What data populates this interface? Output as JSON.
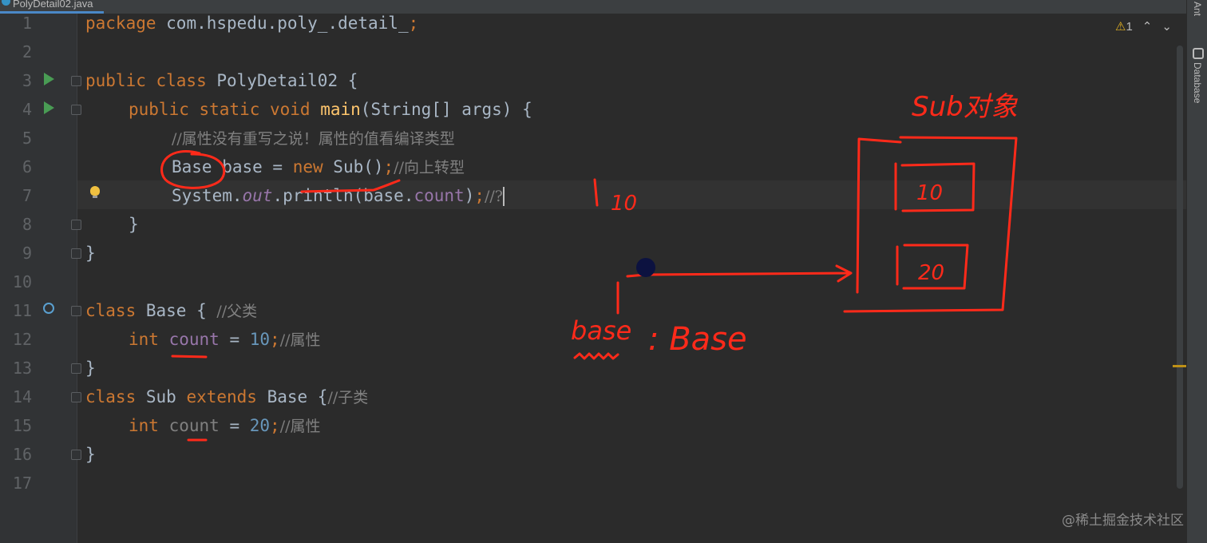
{
  "tab": {
    "filename": "PolyDetail02.java"
  },
  "editor": {
    "line_numbers": [
      "1",
      "2",
      "3",
      "4",
      "5",
      "6",
      "7",
      "8",
      "9",
      "10",
      "11",
      "12",
      "13",
      "14",
      "15",
      "16",
      "17"
    ],
    "code": {
      "l1_kw": "package ",
      "l1_rest": "com.hspedu.poly_.detail_",
      "l1_semi": ";",
      "l3_kw": "public class ",
      "l3_name": "PolyDetail02 {",
      "l4_kw": "public static void ",
      "l4_fn": "main",
      "l4_rest": "(String[] args) {",
      "l5_comment": "//属性没有重写之说！属性的值看编译类型",
      "l6_a": "Base base = ",
      "l6_kw": "new ",
      "l6_b": "Sub()",
      "l6_semi": ";",
      "l6_comment": "//向上转型",
      "l7_a": "System.",
      "l7_out": "out",
      "l7_b": ".println(base.",
      "l7_count": "count",
      "l7_c": ")",
      "l7_semi": ";",
      "l7_comment": "//?",
      "l8": "}",
      "l9": "}",
      "l11_kw": "class ",
      "l11_name": "Base { ",
      "l11_comment": "//父类",
      "l12_kw": "int ",
      "l12_field": "count",
      "l12_eq": " = ",
      "l12_num": "10",
      "l12_semi": ";",
      "l12_comment": "//属性",
      "l13": "}",
      "l14_kw": "class ",
      "l14_name": "Sub ",
      "l14_kw2": "extends ",
      "l14_base": "Base {",
      "l14_comment": "//子类",
      "l15_kw": "int ",
      "l15_field": "count",
      "l15_eq": " = ",
      "l15_num": "20",
      "l15_semi": ";",
      "l15_comment": "//属性",
      "l16": "}"
    }
  },
  "inspection": {
    "warning_count": "1",
    "up_arrow": "⌃",
    "down_arrow": "⌄"
  },
  "right_sidebar": {
    "ant_label": "Ant",
    "database_label": "Database"
  },
  "annotations": {
    "sub_object_label": "Sub对象",
    "output_value": "10",
    "box_value_1": "10",
    "box_value_2": "20",
    "ref_name": "base",
    "ref_type": ": Base"
  },
  "watermark": "@稀土掘金技术社区",
  "colors": {
    "ink": "#ff2a1a",
    "keyword": "#cc7832",
    "function": "#ffc66d",
    "number": "#6897bb",
    "field": "#9876aa",
    "comment": "#808080",
    "text": "#a9b7c6"
  }
}
